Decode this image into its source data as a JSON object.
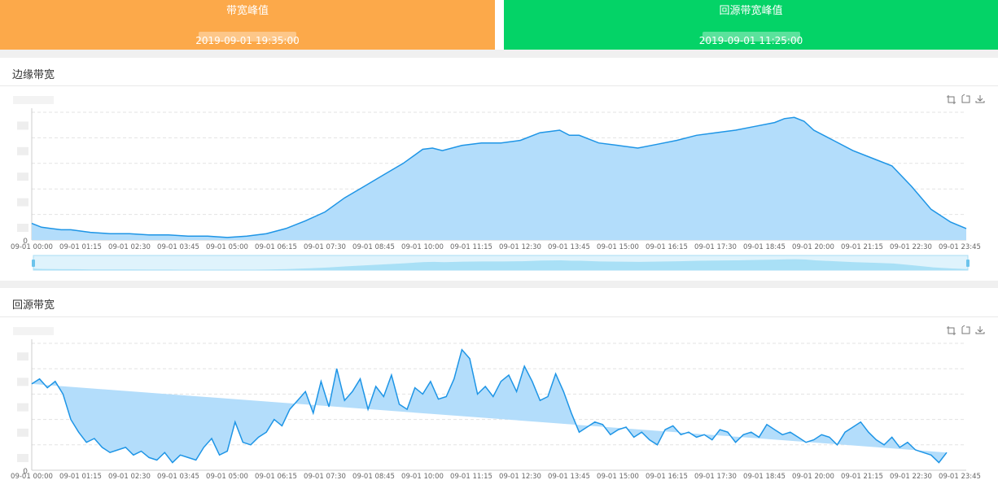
{
  "cards": {
    "edge": {
      "title": "带宽峰值",
      "time": "2019-09-01 19:35:00",
      "color": "#fca94a"
    },
    "origin": {
      "title": "回源带宽峰值",
      "time": "2019-09-01 11:25:00",
      "color": "#04d367"
    }
  },
  "sections": {
    "edge_title": "边缘带宽",
    "origin_title": "回源带宽"
  },
  "toolbar_icons": [
    "zoom-icon",
    "zoom-reset-icon",
    "download-icon"
  ],
  "colors": {
    "line": "#1e95e6",
    "area": "#b3ddfb",
    "slider": "#cfeefc"
  },
  "chart_data": [
    {
      "type": "area",
      "id": "edge",
      "title": "",
      "ylabel": "",
      "x_ticks": [
        "09-01 00:00",
        "09-01 01:15",
        "09-01 02:30",
        "09-01 03:45",
        "09-01 05:00",
        "09-01 06:15",
        "09-01 07:30",
        "09-01 08:45",
        "09-01 10:00",
        "09-01 11:15",
        "09-01 12:30",
        "09-01 13:45",
        "09-01 15:00",
        "09-01 16:15",
        "09-01 17:30",
        "09-01 18:45",
        "09-01 20:00",
        "09-01 21:15",
        "09-01 22:30",
        "09-01 23:45"
      ],
      "y_tick_zero": "0",
      "ylim": [
        0,
        100
      ],
      "grid": true,
      "dataZoom": true,
      "series": [
        {
          "x_hours": [
            0,
            0.25,
            0.5,
            0.75,
            1,
            1.25,
            1.5,
            2,
            2.5,
            3,
            3.5,
            4,
            4.5,
            5,
            5.5,
            6,
            6.5,
            7,
            7.5,
            8,
            8.5,
            9,
            9.5,
            10,
            10.25,
            10.5,
            11,
            11.5,
            12,
            12.5,
            13,
            13.25,
            13.5,
            13.75,
            14,
            14.5,
            15,
            15.5,
            16,
            16.5,
            17,
            17.5,
            18,
            18.5,
            19,
            19.25,
            19.5,
            19.75,
            20,
            20.5,
            21,
            21.5,
            22,
            22.5,
            23,
            23.5,
            23.9
          ],
          "values": [
            13,
            10,
            9,
            8,
            8,
            7,
            6,
            5,
            5,
            4,
            4,
            3,
            3,
            2,
            3,
            5,
            9,
            15,
            22,
            33,
            42,
            51,
            60,
            71,
            72,
            70,
            74,
            76,
            76,
            78,
            84,
            85,
            86,
            82,
            82,
            76,
            74,
            72,
            75,
            78,
            82,
            84,
            86,
            89,
            92,
            95,
            96,
            93,
            86,
            78,
            70,
            64,
            58,
            42,
            24,
            14,
            9
          ]
        }
      ]
    },
    {
      "type": "area",
      "id": "origin",
      "title": "",
      "ylabel": "",
      "x_ticks": [
        "09-01 00:00",
        "09-01 01:15",
        "09-01 02:30",
        "09-01 03:45",
        "09-01 05:00",
        "09-01 06:15",
        "09-01 07:30",
        "09-01 08:45",
        "09-01 10:00",
        "09-01 11:15",
        "09-01 12:30",
        "09-01 13:45",
        "09-01 15:00",
        "09-01 16:15",
        "09-01 17:30",
        "09-01 18:45",
        "09-01 20:00",
        "09-01 21:15",
        "09-01 22:30",
        "09-01 23:45"
      ],
      "y_tick_zero": "0",
      "ylim": [
        0,
        100
      ],
      "grid": true,
      "series": [
        {
          "x_hours": [
            0,
            0.2,
            0.4,
            0.6,
            0.8,
            1,
            1.2,
            1.4,
            1.6,
            1.8,
            2,
            2.2,
            2.4,
            2.6,
            2.8,
            3,
            3.2,
            3.4,
            3.6,
            3.8,
            4,
            4.2,
            4.4,
            4.6,
            4.8,
            5,
            5.2,
            5.4,
            5.6,
            5.8,
            6,
            6.2,
            6.4,
            6.6,
            6.8,
            7,
            7.2,
            7.4,
            7.6,
            7.8,
            8,
            8.2,
            8.4,
            8.6,
            8.8,
            9,
            9.2,
            9.4,
            9.6,
            9.8,
            10,
            10.2,
            10.4,
            10.6,
            10.8,
            11,
            11.2,
            11.4,
            11.6,
            11.8,
            12,
            12.2,
            12.4,
            12.6,
            12.8,
            13,
            13.2,
            13.4,
            13.6,
            13.8,
            14,
            14.2,
            14.4,
            14.6,
            14.8,
            15,
            15.2,
            15.4,
            15.6,
            15.8,
            16,
            16.2,
            16.4,
            16.6,
            16.8,
            17,
            17.2,
            17.4,
            17.6,
            17.8,
            18,
            18.2,
            18.4,
            18.6,
            18.8,
            19,
            19.2,
            19.4,
            19.6,
            19.8,
            20,
            20.2,
            20.4,
            20.6,
            20.8,
            21,
            21.2,
            21.4,
            21.6,
            21.8,
            22,
            22.2,
            22.4,
            22.6,
            22.8,
            23,
            23.2,
            23.4,
            23.6,
            23.8,
            23.9
          ],
          "values": [
            68,
            72,
            65,
            70,
            60,
            40,
            30,
            22,
            25,
            18,
            14,
            16,
            18,
            12,
            15,
            10,
            8,
            14,
            6,
            12,
            10,
            8,
            18,
            25,
            12,
            15,
            38,
            22,
            20,
            26,
            30,
            40,
            35,
            48,
            55,
            62,
            45,
            70,
            50,
            80,
            55,
            62,
            72,
            48,
            66,
            58,
            75,
            52,
            48,
            65,
            60,
            70,
            56,
            58,
            72,
            95,
            88,
            60,
            66,
            58,
            70,
            75,
            62,
            82,
            70,
            55,
            58,
            76,
            62,
            45,
            30,
            34,
            38,
            36,
            28,
            32,
            34,
            26,
            30,
            24,
            20,
            32,
            35,
            28,
            30,
            26,
            28,
            24,
            32,
            30,
            22,
            28,
            30,
            26,
            36,
            32,
            28,
            30,
            26,
            22,
            24,
            28,
            26,
            20,
            30,
            34,
            38,
            30,
            24,
            20,
            26,
            18,
            22,
            16,
            14,
            12,
            6,
            14
          ]
        }
      ]
    }
  ]
}
